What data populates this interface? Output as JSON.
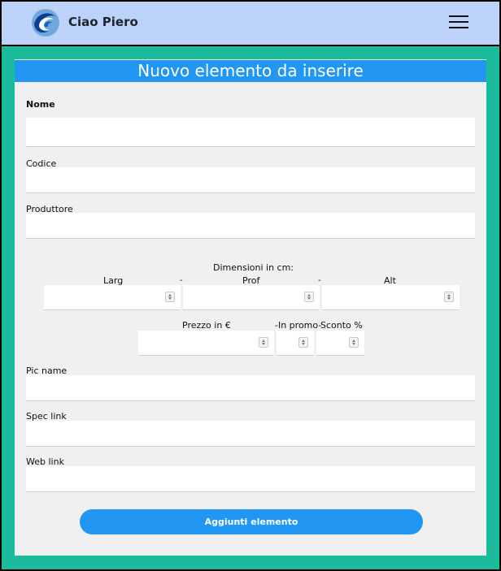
{
  "header": {
    "brand": "Ciao Piero",
    "logo_icon": "wave-logo-icon",
    "menu_icon": "hamburger-menu-icon"
  },
  "form": {
    "title": "Nuovo elemento da inserire",
    "nome_label": "Nome",
    "codice_label": "Codice",
    "produttore_label": "Produttore",
    "dimensioni_label": "Dimensioni in cm:",
    "larg_label": "Larg",
    "prof_label": "Prof",
    "alt_label": "Alt",
    "dash": "-",
    "prezzo_label": "Prezzo in €",
    "promo_label": "-In promo-",
    "sconto_label": "Sconto %",
    "pic_label": "Pic name",
    "spec_label": "Spec link",
    "web_label": "Web link",
    "submit_label": "Aggiunti elemento"
  },
  "colors": {
    "background": "#1abc9c",
    "navbar": "#bcd2f8",
    "accent": "#2196f3",
    "panel": "#f0f0f0"
  }
}
